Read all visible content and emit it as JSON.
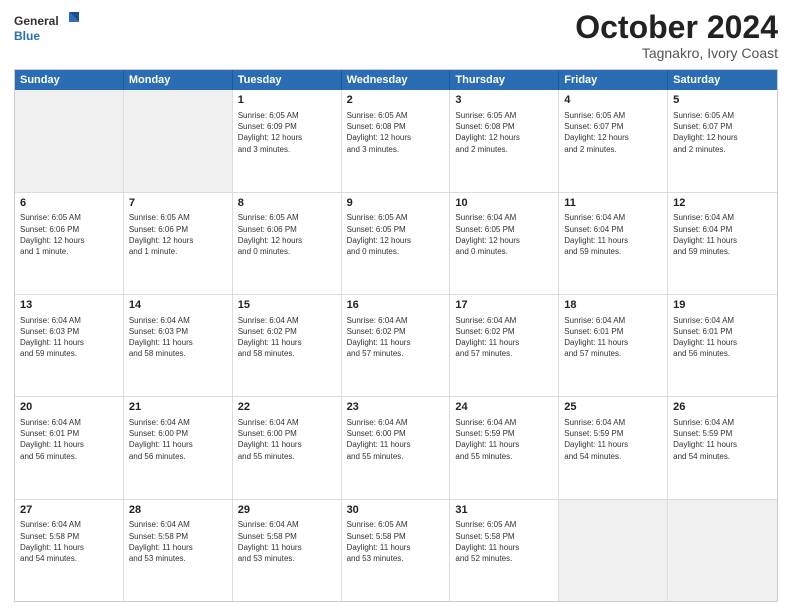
{
  "logo": {
    "line1": "General",
    "line2": "Blue"
  },
  "title": "October 2024",
  "subtitle": "Tagnakro, Ivory Coast",
  "header_days": [
    "Sunday",
    "Monday",
    "Tuesday",
    "Wednesday",
    "Thursday",
    "Friday",
    "Saturday"
  ],
  "weeks": [
    [
      {
        "day": "",
        "info": "",
        "shaded": true,
        "empty": true
      },
      {
        "day": "",
        "info": "",
        "shaded": true,
        "empty": true
      },
      {
        "day": "1",
        "info": "Sunrise: 6:05 AM\nSunset: 6:09 PM\nDaylight: 12 hours\nand 3 minutes."
      },
      {
        "day": "2",
        "info": "Sunrise: 6:05 AM\nSunset: 6:08 PM\nDaylight: 12 hours\nand 3 minutes."
      },
      {
        "day": "3",
        "info": "Sunrise: 6:05 AM\nSunset: 6:08 PM\nDaylight: 12 hours\nand 2 minutes."
      },
      {
        "day": "4",
        "info": "Sunrise: 6:05 AM\nSunset: 6:07 PM\nDaylight: 12 hours\nand 2 minutes."
      },
      {
        "day": "5",
        "info": "Sunrise: 6:05 AM\nSunset: 6:07 PM\nDaylight: 12 hours\nand 2 minutes."
      }
    ],
    [
      {
        "day": "6",
        "info": "Sunrise: 6:05 AM\nSunset: 6:06 PM\nDaylight: 12 hours\nand 1 minute."
      },
      {
        "day": "7",
        "info": "Sunrise: 6:05 AM\nSunset: 6:06 PM\nDaylight: 12 hours\nand 1 minute."
      },
      {
        "day": "8",
        "info": "Sunrise: 6:05 AM\nSunset: 6:06 PM\nDaylight: 12 hours\nand 0 minutes."
      },
      {
        "day": "9",
        "info": "Sunrise: 6:05 AM\nSunset: 6:05 PM\nDaylight: 12 hours\nand 0 minutes."
      },
      {
        "day": "10",
        "info": "Sunrise: 6:04 AM\nSunset: 6:05 PM\nDaylight: 12 hours\nand 0 minutes."
      },
      {
        "day": "11",
        "info": "Sunrise: 6:04 AM\nSunset: 6:04 PM\nDaylight: 11 hours\nand 59 minutes."
      },
      {
        "day": "12",
        "info": "Sunrise: 6:04 AM\nSunset: 6:04 PM\nDaylight: 11 hours\nand 59 minutes."
      }
    ],
    [
      {
        "day": "13",
        "info": "Sunrise: 6:04 AM\nSunset: 6:03 PM\nDaylight: 11 hours\nand 59 minutes."
      },
      {
        "day": "14",
        "info": "Sunrise: 6:04 AM\nSunset: 6:03 PM\nDaylight: 11 hours\nand 58 minutes."
      },
      {
        "day": "15",
        "info": "Sunrise: 6:04 AM\nSunset: 6:02 PM\nDaylight: 11 hours\nand 58 minutes."
      },
      {
        "day": "16",
        "info": "Sunrise: 6:04 AM\nSunset: 6:02 PM\nDaylight: 11 hours\nand 57 minutes."
      },
      {
        "day": "17",
        "info": "Sunrise: 6:04 AM\nSunset: 6:02 PM\nDaylight: 11 hours\nand 57 minutes."
      },
      {
        "day": "18",
        "info": "Sunrise: 6:04 AM\nSunset: 6:01 PM\nDaylight: 11 hours\nand 57 minutes."
      },
      {
        "day": "19",
        "info": "Sunrise: 6:04 AM\nSunset: 6:01 PM\nDaylight: 11 hours\nand 56 minutes."
      }
    ],
    [
      {
        "day": "20",
        "info": "Sunrise: 6:04 AM\nSunset: 6:01 PM\nDaylight: 11 hours\nand 56 minutes."
      },
      {
        "day": "21",
        "info": "Sunrise: 6:04 AM\nSunset: 6:00 PM\nDaylight: 11 hours\nand 56 minutes."
      },
      {
        "day": "22",
        "info": "Sunrise: 6:04 AM\nSunset: 6:00 PM\nDaylight: 11 hours\nand 55 minutes."
      },
      {
        "day": "23",
        "info": "Sunrise: 6:04 AM\nSunset: 6:00 PM\nDaylight: 11 hours\nand 55 minutes."
      },
      {
        "day": "24",
        "info": "Sunrise: 6:04 AM\nSunset: 5:59 PM\nDaylight: 11 hours\nand 55 minutes."
      },
      {
        "day": "25",
        "info": "Sunrise: 6:04 AM\nSunset: 5:59 PM\nDaylight: 11 hours\nand 54 minutes."
      },
      {
        "day": "26",
        "info": "Sunrise: 6:04 AM\nSunset: 5:59 PM\nDaylight: 11 hours\nand 54 minutes."
      }
    ],
    [
      {
        "day": "27",
        "info": "Sunrise: 6:04 AM\nSunset: 5:58 PM\nDaylight: 11 hours\nand 54 minutes."
      },
      {
        "day": "28",
        "info": "Sunrise: 6:04 AM\nSunset: 5:58 PM\nDaylight: 11 hours\nand 53 minutes."
      },
      {
        "day": "29",
        "info": "Sunrise: 6:04 AM\nSunset: 5:58 PM\nDaylight: 11 hours\nand 53 minutes."
      },
      {
        "day": "30",
        "info": "Sunrise: 6:05 AM\nSunset: 5:58 PM\nDaylight: 11 hours\nand 53 minutes."
      },
      {
        "day": "31",
        "info": "Sunrise: 6:05 AM\nSunset: 5:58 PM\nDaylight: 11 hours\nand 52 minutes."
      },
      {
        "day": "",
        "info": "",
        "shaded": true,
        "empty": true
      },
      {
        "day": "",
        "info": "",
        "shaded": true,
        "empty": true
      }
    ]
  ]
}
